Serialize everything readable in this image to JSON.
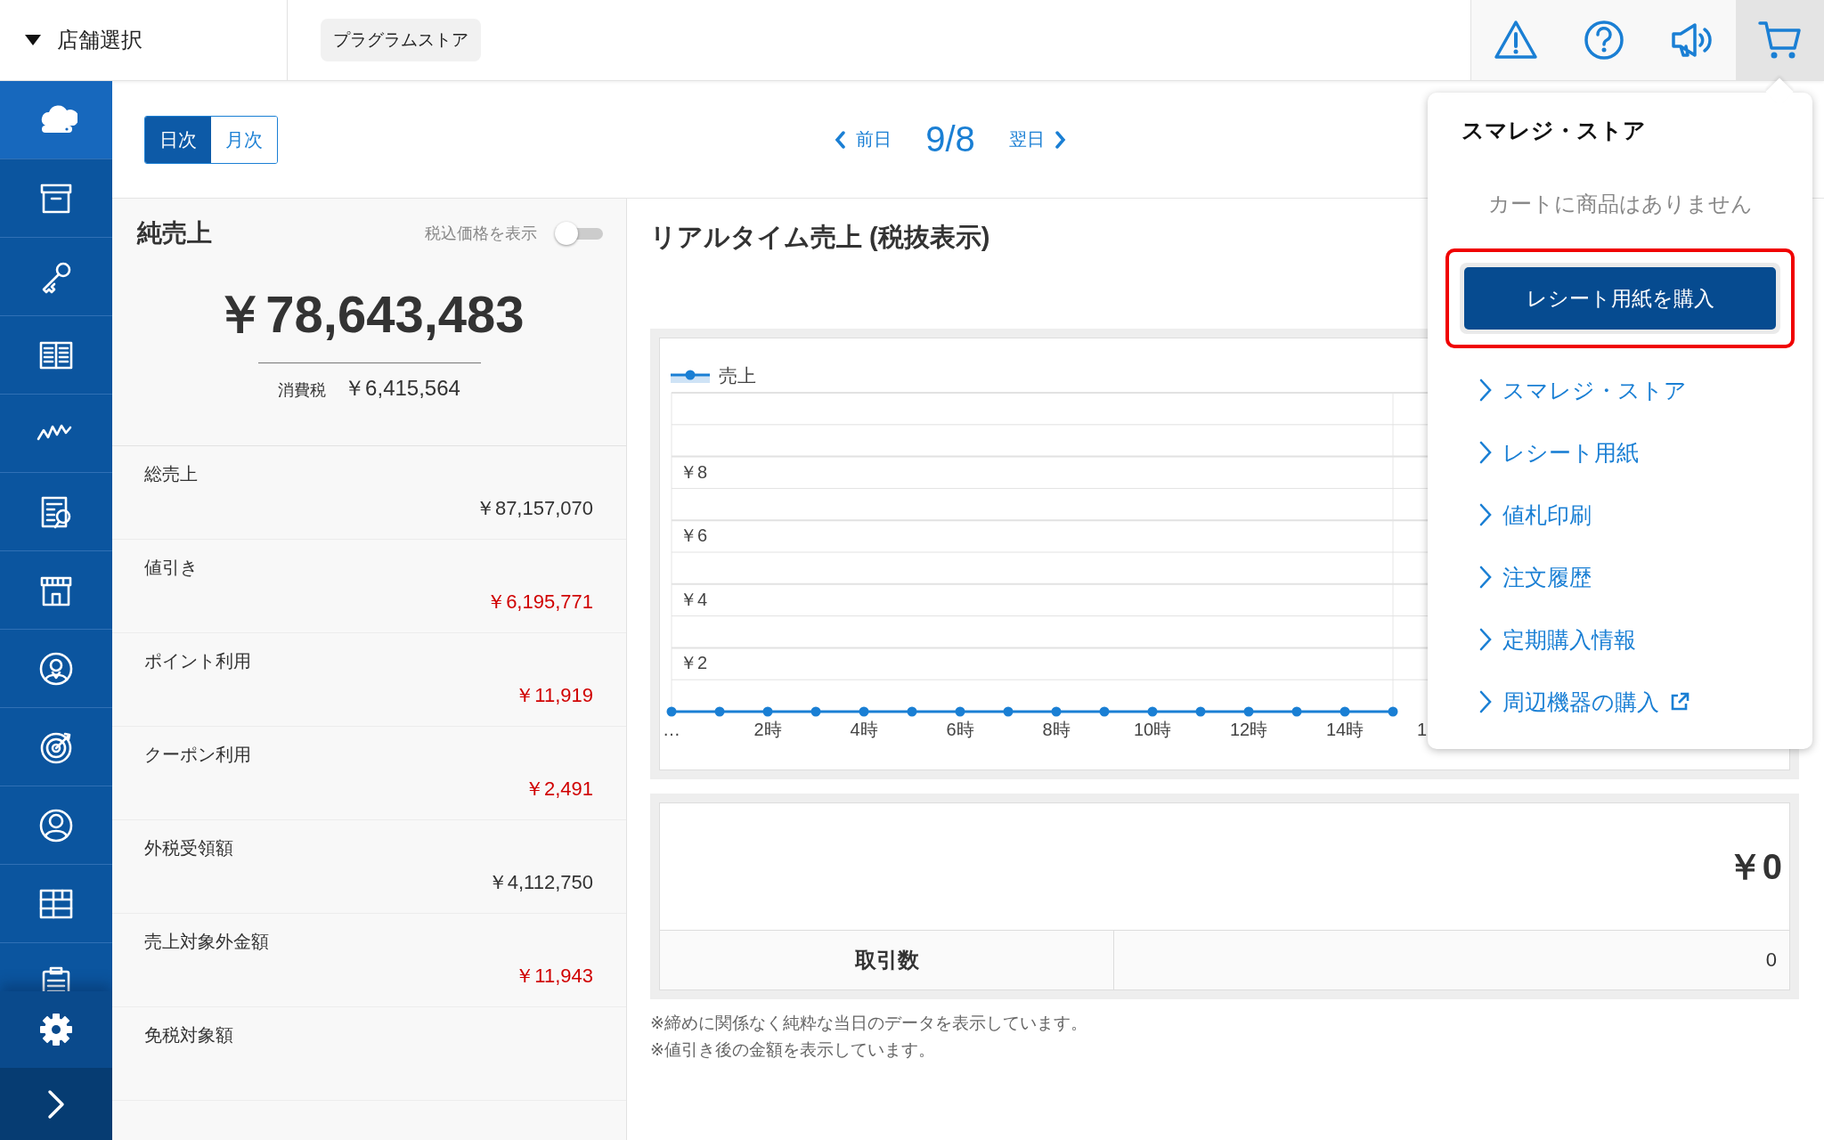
{
  "store_selector": {
    "label": "店舗選択"
  },
  "store_tag": "プラグラムストア",
  "header_icons": [
    {
      "kind": "warning",
      "selected": false
    },
    {
      "kind": "help",
      "selected": false
    },
    {
      "kind": "announce",
      "selected": false
    },
    {
      "kind": "cart",
      "selected": true
    }
  ],
  "sidebar": {
    "items": [
      {
        "kind": "cloud",
        "selected": true
      },
      {
        "kind": "archive",
        "selected": false
      },
      {
        "kind": "key",
        "selected": false
      },
      {
        "kind": "book",
        "selected": false
      },
      {
        "kind": "activity",
        "selected": false
      },
      {
        "kind": "report",
        "selected": false
      },
      {
        "kind": "store",
        "selected": false
      },
      {
        "kind": "customer",
        "selected": false
      },
      {
        "kind": "target",
        "selected": false
      },
      {
        "kind": "user",
        "selected": false
      },
      {
        "kind": "grid",
        "selected": false
      },
      {
        "kind": "clipboard",
        "selected": false
      }
    ]
  },
  "period_tabs": [
    {
      "label": "日次",
      "selected": true
    },
    {
      "label": "月次",
      "selected": false
    }
  ],
  "date_nav": {
    "prev": "前日",
    "date": "9/8",
    "next": "翌日"
  },
  "net_sales": {
    "title": "純売上",
    "tax_toggle": {
      "label": "税込価格を表示",
      "on": false
    },
    "amount": "￥78,643,483",
    "tax_label": "消費税",
    "tax_amount": "￥6,415,564",
    "rows": [
      {
        "label": "総売上",
        "value": "￥87,157,070",
        "negative": false
      },
      {
        "label": "値引き",
        "value": "￥6,195,771",
        "negative": true
      },
      {
        "label": "ポイント利用",
        "value": "￥11,919",
        "negative": true
      },
      {
        "label": "クーポン利用",
        "value": "￥2,491",
        "negative": true
      },
      {
        "label": "外税受領額",
        "value": "￥4,112,750",
        "negative": false
      },
      {
        "label": "売上対象外金額",
        "value": "￥11,943",
        "negative": true
      },
      {
        "label": "免税対象額"
      }
    ]
  },
  "realtime": {
    "title": "リアルタイム売上 (税抜表示)",
    "chart_data": {
      "type": "line",
      "x": [
        0,
        1,
        2,
        3,
        4,
        5,
        6,
        7,
        8,
        9,
        10,
        11,
        12,
        13,
        14,
        15
      ],
      "series": [
        {
          "name": "売上",
          "color": "#1a7fd4",
          "marker": true,
          "values": [
            0,
            0,
            0,
            0,
            0,
            0,
            0,
            0,
            0,
            0,
            0,
            0,
            0,
            0,
            0,
            0
          ]
        }
      ],
      "grid": true,
      "xlim": [
        0,
        15
      ],
      "ylim": [
        0,
        10
      ],
      "xticks": [
        {
          "value": 0,
          "label": "…"
        },
        {
          "value": 2,
          "label": "2時"
        },
        {
          "value": 4,
          "label": "4時"
        },
        {
          "value": 6,
          "label": "6時"
        },
        {
          "value": 8,
          "label": "8時"
        },
        {
          "value": 10,
          "label": "10時"
        },
        {
          "value": 12,
          "label": "12時"
        },
        {
          "value": 14,
          "label": "14時"
        }
      ],
      "yticks": [
        {
          "value": 2,
          "label": "￥2"
        },
        {
          "value": 4,
          "label": "￥4"
        },
        {
          "value": 6,
          "label": "￥6"
        },
        {
          "value": 8,
          "label": "￥8"
        }
      ]
    },
    "axis_label_fragment": "1",
    "total": "￥0",
    "transactions": {
      "label": "取引数",
      "value": "0"
    },
    "notes": [
      "※締めに関係なく純粋な当日のデータを表示しています。",
      "※値引き後の金額を表示しています。"
    ]
  },
  "cart_dropdown": {
    "title": "スマレジ・ストア",
    "empty_message": "カートに商品はありません",
    "primary_button": "レシート用紙を購入",
    "highlighted": true,
    "links": [
      {
        "label": "スマレジ・ストア",
        "external": false
      },
      {
        "label": "レシート用紙",
        "external": false
      },
      {
        "label": "値札印刷",
        "external": false
      },
      {
        "label": "注文履歴",
        "external": false
      },
      {
        "label": "定期購入情報",
        "external": false
      },
      {
        "label": "周辺機器の購入",
        "external": true
      }
    ]
  }
}
